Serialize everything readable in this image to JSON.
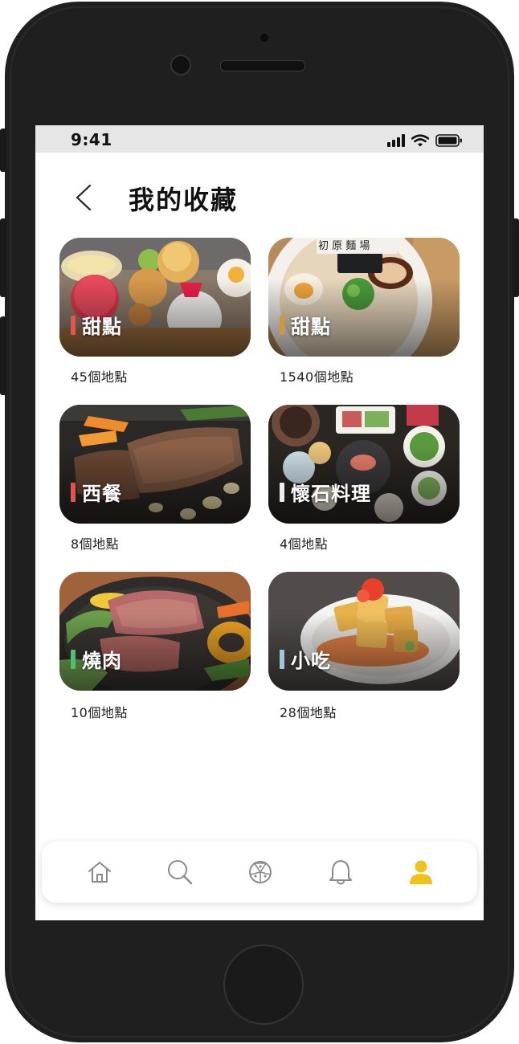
{
  "status_bar": {
    "time": "9:41"
  },
  "header": {
    "back_icon": "chevron-left-icon",
    "title": "我的收藏"
  },
  "categories": [
    {
      "label": "甜點",
      "count": "45個地點",
      "accent": "#e25454",
      "photo": "desserts"
    },
    {
      "label": "甜點",
      "count": "1540個地點",
      "accent": "#d4963c",
      "photo": "ramen"
    },
    {
      "label": "西餐",
      "count": "8個地點",
      "accent": "#e25454",
      "photo": "steak"
    },
    {
      "label": "懷石料理",
      "count": "4個地點",
      "accent": "#eeeeee",
      "photo": "kaiseki"
    },
    {
      "label": "燒肉",
      "count": "10個地點",
      "accent": "#4cc36a",
      "photo": "grilled-meat"
    },
    {
      "label": "小吃",
      "count": "28個地點",
      "accent": "#9cc8d8",
      "photo": "fried-tofu"
    }
  ],
  "tab_bar": {
    "items": [
      {
        "icon": "home-icon",
        "active": false
      },
      {
        "icon": "search-icon",
        "active": false
      },
      {
        "icon": "pizza-icon",
        "active": false
      },
      {
        "icon": "bell-icon",
        "active": false
      },
      {
        "icon": "profile-icon",
        "active": true
      }
    ],
    "active_color": "#f3c21a",
    "inactive_color": "#8a8a8a"
  }
}
